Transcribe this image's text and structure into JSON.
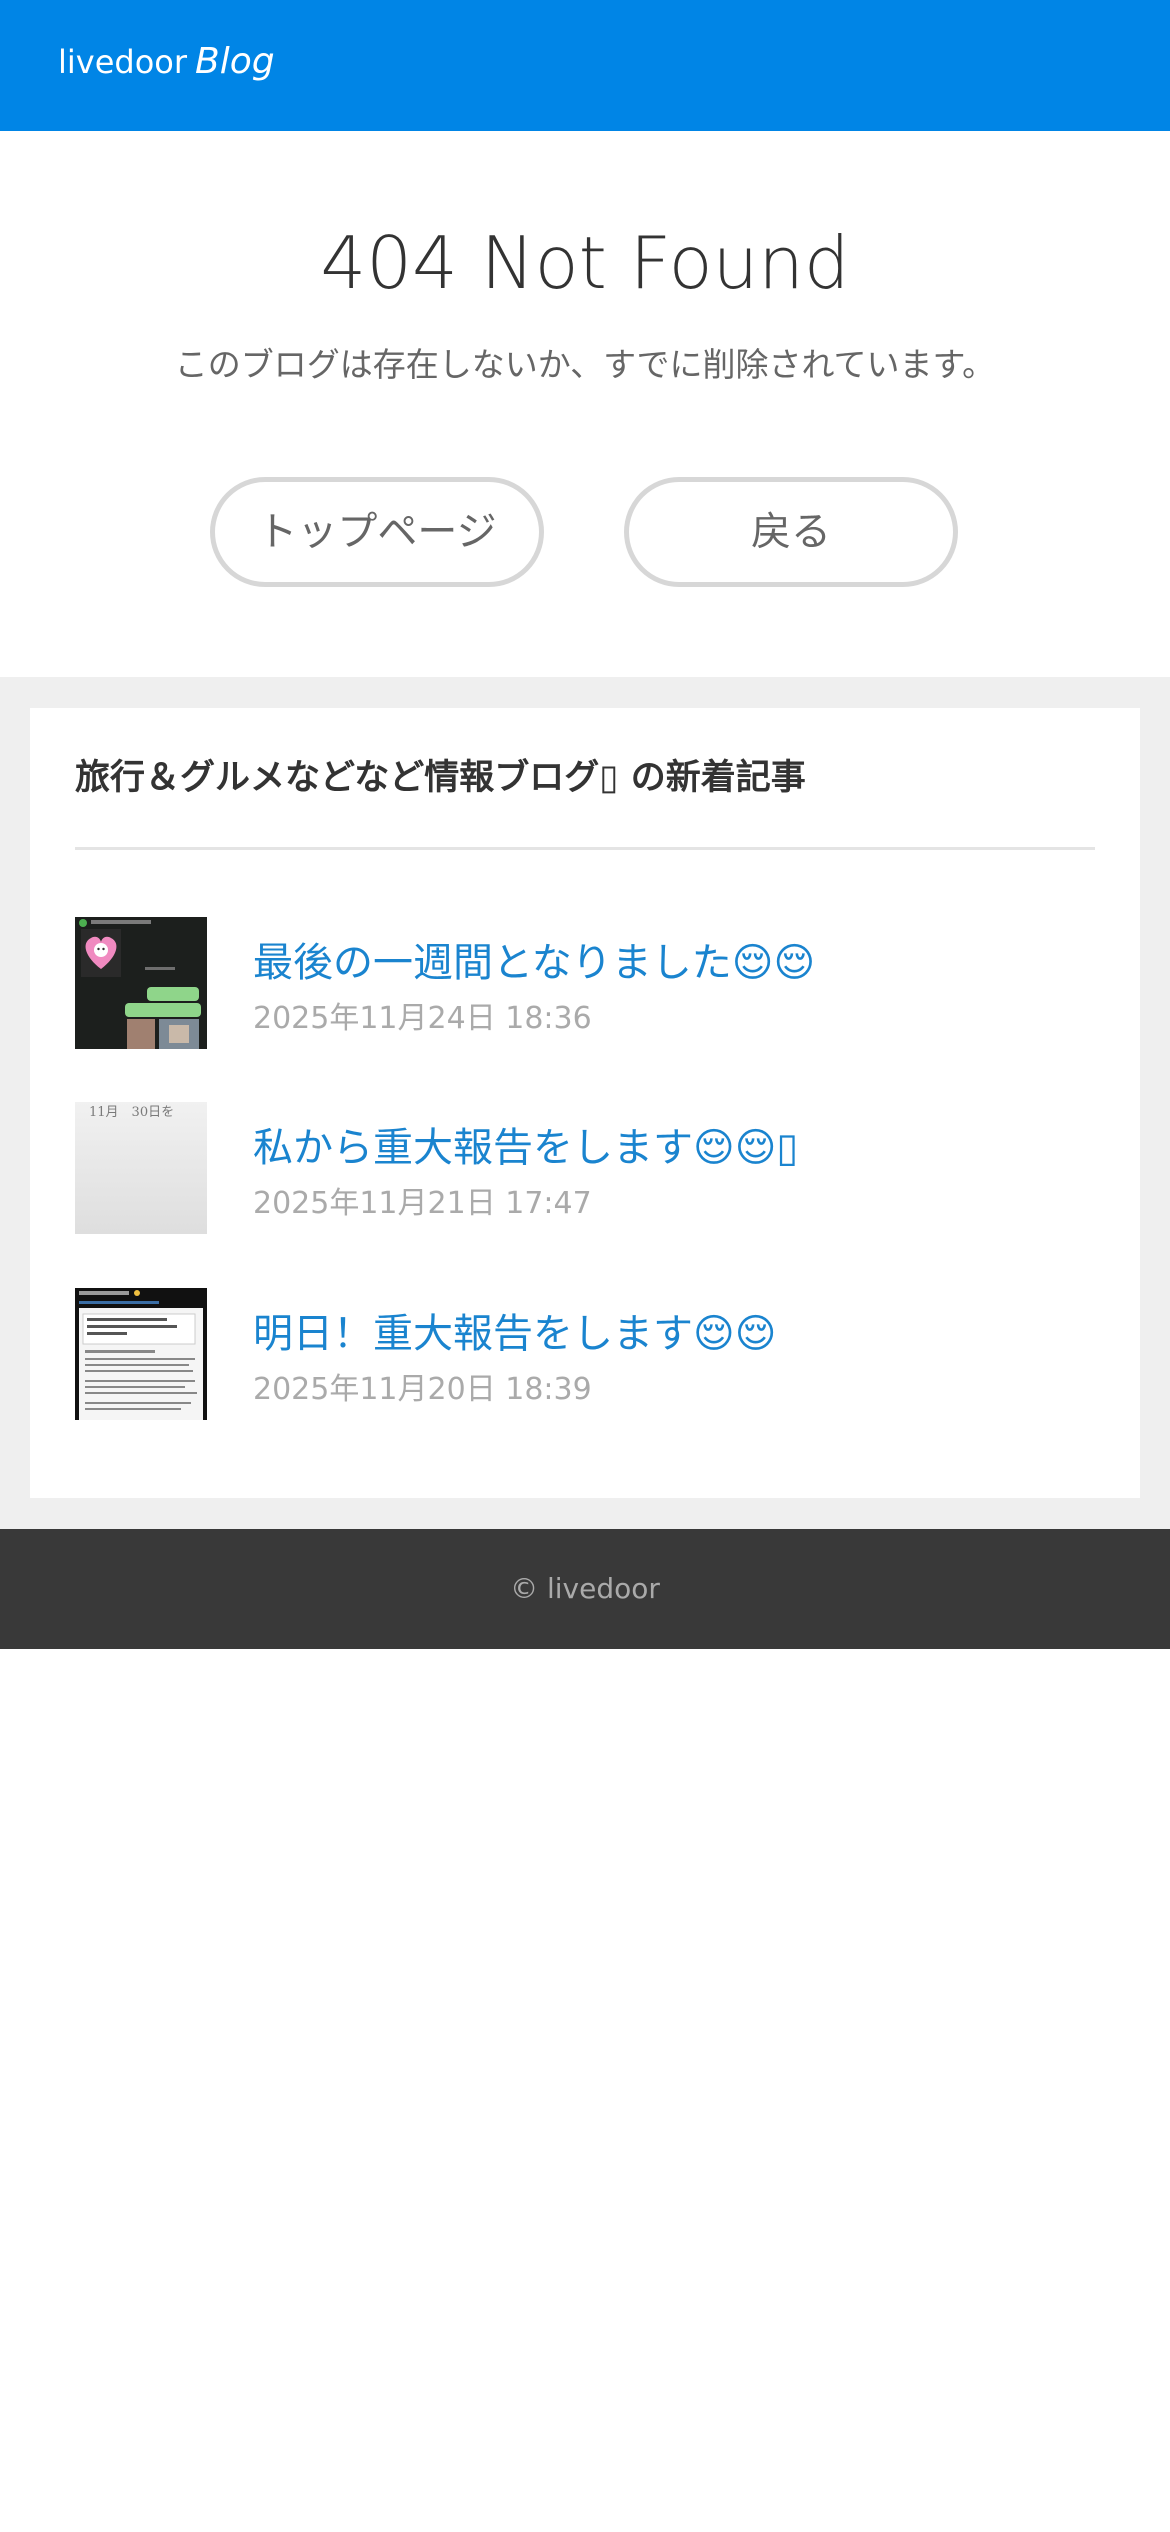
{
  "header": {
    "logo_main": "livedoor",
    "logo_sub": "Blog",
    "background_color": "#0085e6"
  },
  "error": {
    "title": "404 Not Found",
    "message": "このブログは存在しないか、すでに削除されています。"
  },
  "buttons": {
    "top_page": "トップページ",
    "back": "戻る"
  },
  "recent": {
    "heading": "旅行＆グルメなどなど情報ブログ▯ の新着記事",
    "articles": [
      {
        "title": "最後の一週間となりました😌😌",
        "date": "2025年11月24日 18:36",
        "thumbnail": "chat-screenshot-thumbnail"
      },
      {
        "title": "私から重大報告をします😌😌▯",
        "date": "2025年11月21日 17:47",
        "thumbnail": "calendar-note-thumbnail",
        "thumb_text": "11月　30日を"
      },
      {
        "title": "明日！重大報告をします😌😌",
        "date": "2025年11月20日 18:39",
        "thumbnail": "article-screenshot-thumbnail"
      }
    ]
  },
  "footer": {
    "copyright": "© livedoor"
  },
  "colors": {
    "link": "#1a84cf",
    "date": "#aaaaaa",
    "footer_bg": "#393939",
    "band_bg": "#efefef"
  }
}
